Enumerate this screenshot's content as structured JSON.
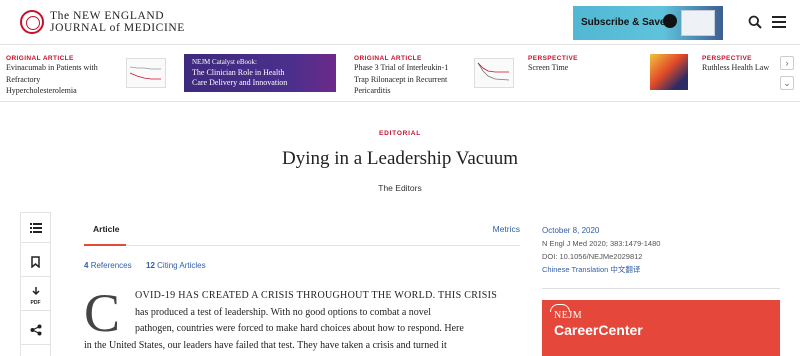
{
  "header": {
    "logo_line1": "The NEW ENGLAND",
    "logo_line2": "JOURNAL of MEDICINE",
    "promo_label": "Subscribe & Save"
  },
  "teasers": [
    {
      "tag": "ORIGINAL ARTICLE",
      "title_lines": [
        "Evinacumab in Patients with",
        "Refractory",
        "Hypercholesterolemia"
      ]
    },
    {
      "tag": "NEJM Catalyst eBook:",
      "title_lines": [
        "The Clinician Role in Health",
        "Care Delivery and Innovation"
      ]
    },
    {
      "tag": "ORIGINAL ARTICLE",
      "title_lines": [
        "Phase 3 Trial of Interleukin-1",
        "Trap Rilonacept in Recurrent",
        "Pericarditis"
      ]
    },
    {
      "tag": "PERSPECTIVE",
      "title_lines": [
        "Screen Time"
      ]
    },
    {
      "tag": "PERSPECTIVE",
      "title_lines": [
        "Ruthless Health Law"
      ]
    }
  ],
  "article": {
    "section": "EDITORIAL",
    "title": "Dying in a Leadership Vacuum",
    "byline": "The Editors",
    "tab_article": "Article",
    "tab_metrics": "Metrics",
    "references_count": "4",
    "references_label": "References",
    "citing_count": "12",
    "citing_label": "Citing Articles",
    "dropcap": "C",
    "body_lines": [
      "OVID-19 HAS CREATED A CRISIS THROUGHOUT THE WORLD. THIS CRISIS",
      "has produced a test of leadership. With no good options to combat a novel",
      "pathogen, countries were forced to make hard choices about how to respond. Here",
      "in the United States, our leaders have failed that test. They have taken a crisis and turned it"
    ]
  },
  "meta": {
    "date": "October 8, 2020",
    "citation": "N Engl J Med 2020; 383:1479-1480",
    "doi": "DOI: 10.1056/NEJMe2029812",
    "translation": "Chinese Translation 中文翻译"
  },
  "career": {
    "brand": "NEJM",
    "name": "CareerCenter"
  },
  "colors": {
    "accent_red": "#c8102e",
    "link_blue": "#2f5fa7",
    "career_red": "#e5483a"
  }
}
